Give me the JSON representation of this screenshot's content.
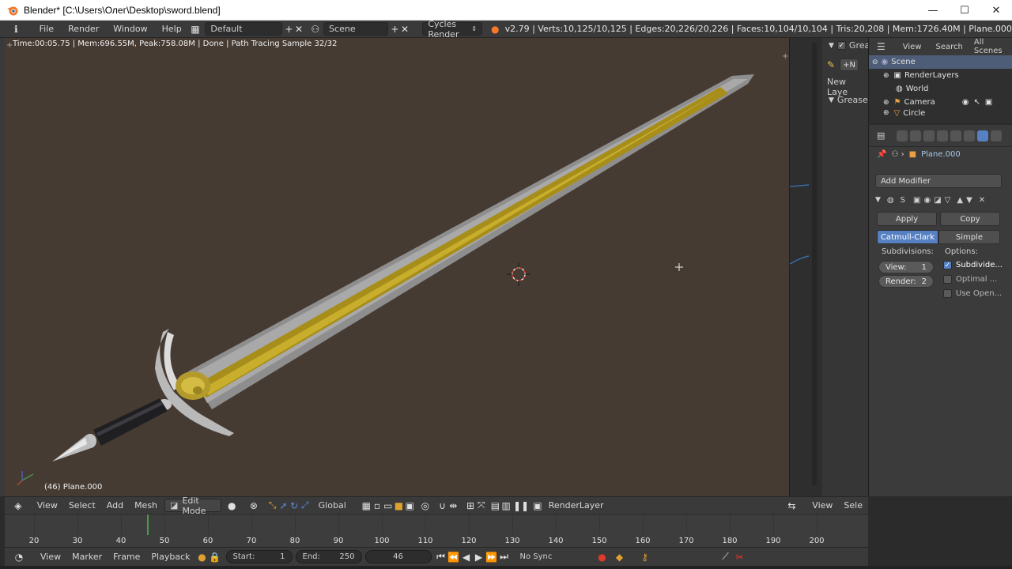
{
  "window": {
    "title": "Blender* [C:\\Users\\Олег\\Desktop\\sword.blend]",
    "minimize": "—",
    "maximize": "☐",
    "close": "✕"
  },
  "infobar": {
    "menus": [
      "File",
      "Render",
      "Window",
      "Help"
    ],
    "screen_layout": "Default",
    "scene": "Scene",
    "render_engine": "Cycles Render",
    "stats": "v2.79 | Verts:10,125/10,125 | Edges:20,226/20,226 | Faces:10,104/10,104 | Tris:20,208 | Mem:1726.40M | Plane.000"
  },
  "viewport": {
    "render_status": "Time:00:05.75 | Mem:696.55M, Peak:758.08M | Done | Path Tracing Sample 32/32",
    "object_label": "(46) Plane.000",
    "colors": {
      "background": "#463b33",
      "blade_edge": "#9a9a9a",
      "fuller": "#a8901c"
    }
  },
  "toolshelf": {
    "grease_tab": "Grea",
    "new_layer": "New Laye",
    "grease_panel": "Grease",
    "add_new": "N"
  },
  "outliner": {
    "view": "View",
    "search": "Search",
    "scope": "All Scenes",
    "items": [
      {
        "label": "Scene"
      },
      {
        "label": "RenderLayers"
      },
      {
        "label": "World"
      },
      {
        "label": "Camera"
      },
      {
        "label": "Circle"
      }
    ]
  },
  "properties": {
    "object_name": "Plane.000",
    "add_modifier": "Add Modifier",
    "modifier_short": "S",
    "apply": "Apply",
    "copy": "Copy",
    "catmull": "Catmull-Clark",
    "simple": "Simple",
    "subdivisions_label": "Subdivisions:",
    "options_label": "Options:",
    "view_label": "View:",
    "view_value": "1",
    "render_label": "Render:",
    "render_value": "2",
    "opt_subdivide": "Subdivide...",
    "opt_optimal": "Optimal ...",
    "opt_use_open": "Use Open..."
  },
  "view_header": {
    "view": "View",
    "select": "Select",
    "add": "Add",
    "mesh": "Mesh",
    "mode": "Edit Mode",
    "orientation": "Global",
    "render_layer": "RenderLayer",
    "view_right": "View",
    "select_right": "Sele"
  },
  "timeline": {
    "ticks": [
      "20",
      "30",
      "40",
      "50",
      "60",
      "70",
      "80",
      "90",
      "100",
      "110",
      "120",
      "130",
      "140",
      "150",
      "160",
      "170",
      "180",
      "190",
      "200"
    ],
    "current_frame": 46
  },
  "time_header": {
    "view": "View",
    "marker": "Marker",
    "frame": "Frame",
    "playback": "Playback",
    "start_label": "Start:",
    "start_value": "1",
    "end_label": "End:",
    "end_value": "250",
    "current": "46",
    "sync": "No Sync"
  }
}
